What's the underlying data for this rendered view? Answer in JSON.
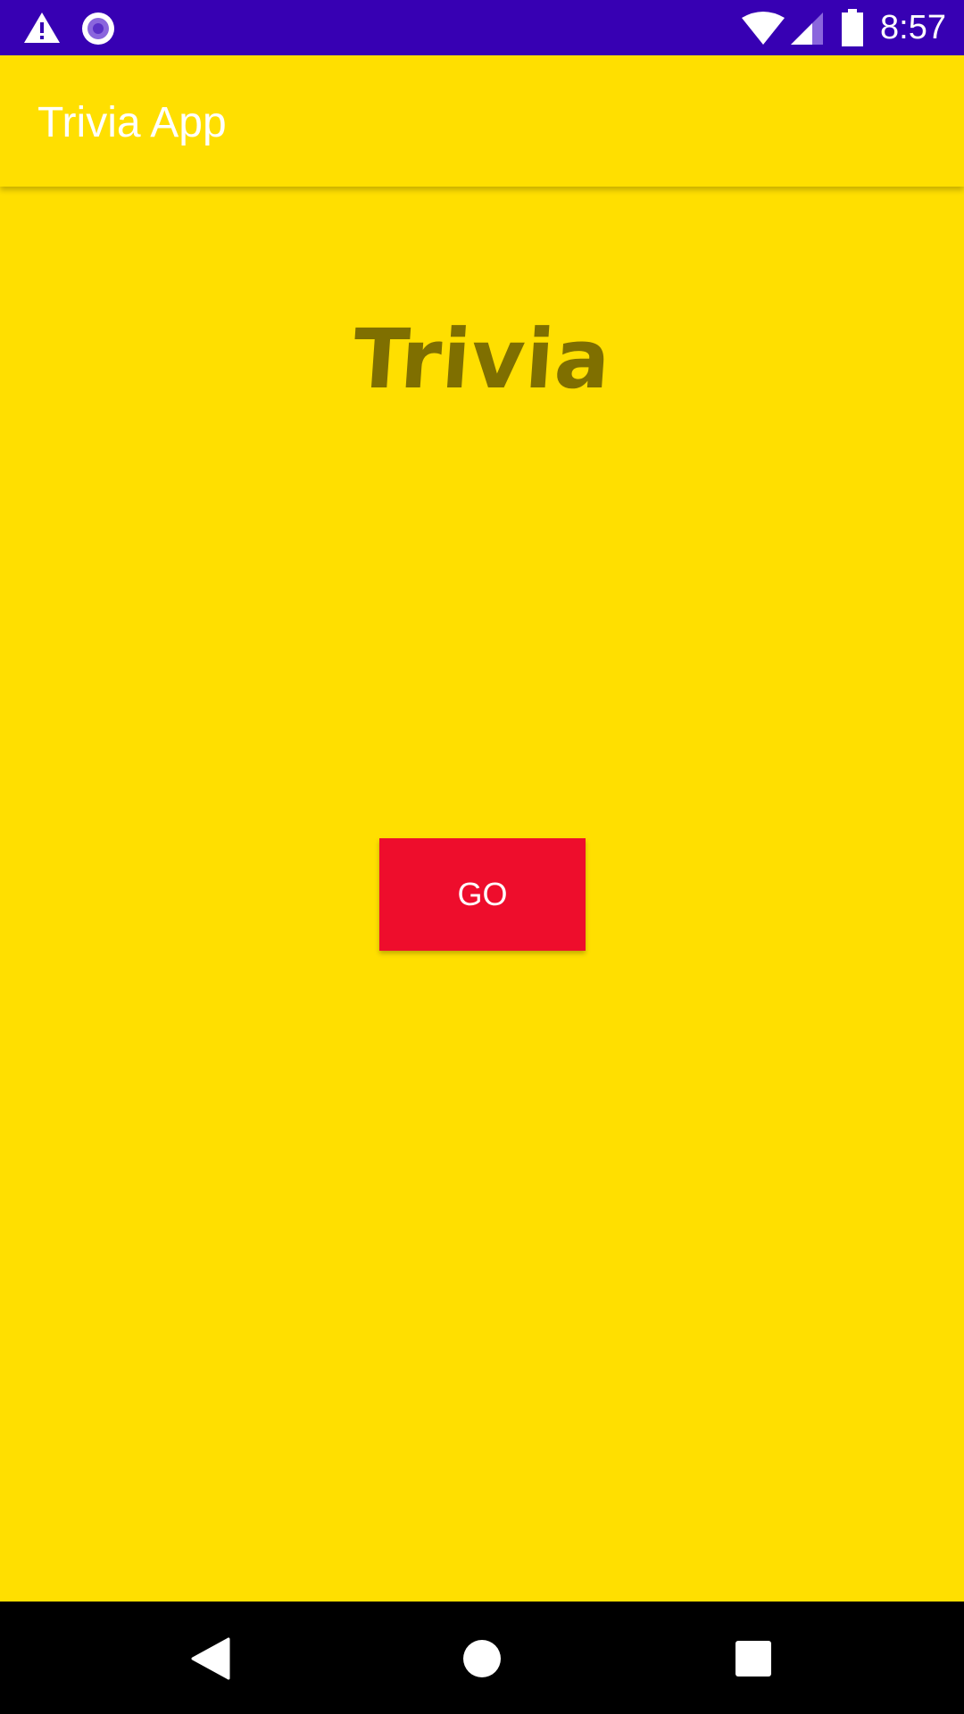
{
  "status_bar": {
    "time": "8:57",
    "icons": [
      "warning-icon",
      "record-icon",
      "wifi-icon",
      "cell-signal-icon",
      "battery-icon"
    ],
    "background_color": "#3700B3"
  },
  "app_bar": {
    "title": "Trivia App",
    "background_color": "#FFDF00"
  },
  "main": {
    "heading": "Trivia",
    "heading_color": "#7F6F00",
    "go_button_label": "GO",
    "go_button_color": "#EE0D2C"
  },
  "nav_bar": {
    "buttons": [
      "back-icon",
      "home-icon",
      "recents-icon"
    ]
  }
}
